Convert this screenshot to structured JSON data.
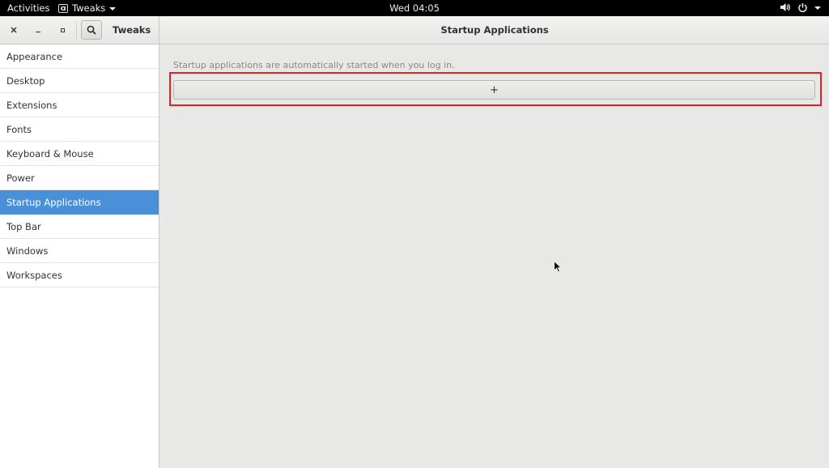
{
  "topbar": {
    "activities": "Activities",
    "app_name": "Tweaks",
    "clock": "Wed 04:05"
  },
  "window": {
    "sidebar_title": "Tweaks",
    "page_title": "Startup Applications"
  },
  "sidebar": {
    "items": [
      {
        "label": "Appearance"
      },
      {
        "label": "Desktop"
      },
      {
        "label": "Extensions"
      },
      {
        "label": "Fonts"
      },
      {
        "label": "Keyboard & Mouse"
      },
      {
        "label": "Power"
      },
      {
        "label": "Startup Applications",
        "selected": true
      },
      {
        "label": "Top Bar"
      },
      {
        "label": "Windows"
      },
      {
        "label": "Workspaces"
      }
    ]
  },
  "main": {
    "description": "Startup applications are automatically started when you log in.",
    "add_label": "+"
  },
  "colors": {
    "selection": "#4a90d9",
    "highlight_box": "#e0202a"
  },
  "icons": {
    "app_menu": "tweaks-app-icon",
    "sound": "speaker-icon",
    "power": "power-icon",
    "search": "search-icon",
    "close": "close-icon",
    "minimize": "minimize-icon",
    "maximize": "maximize-icon"
  }
}
